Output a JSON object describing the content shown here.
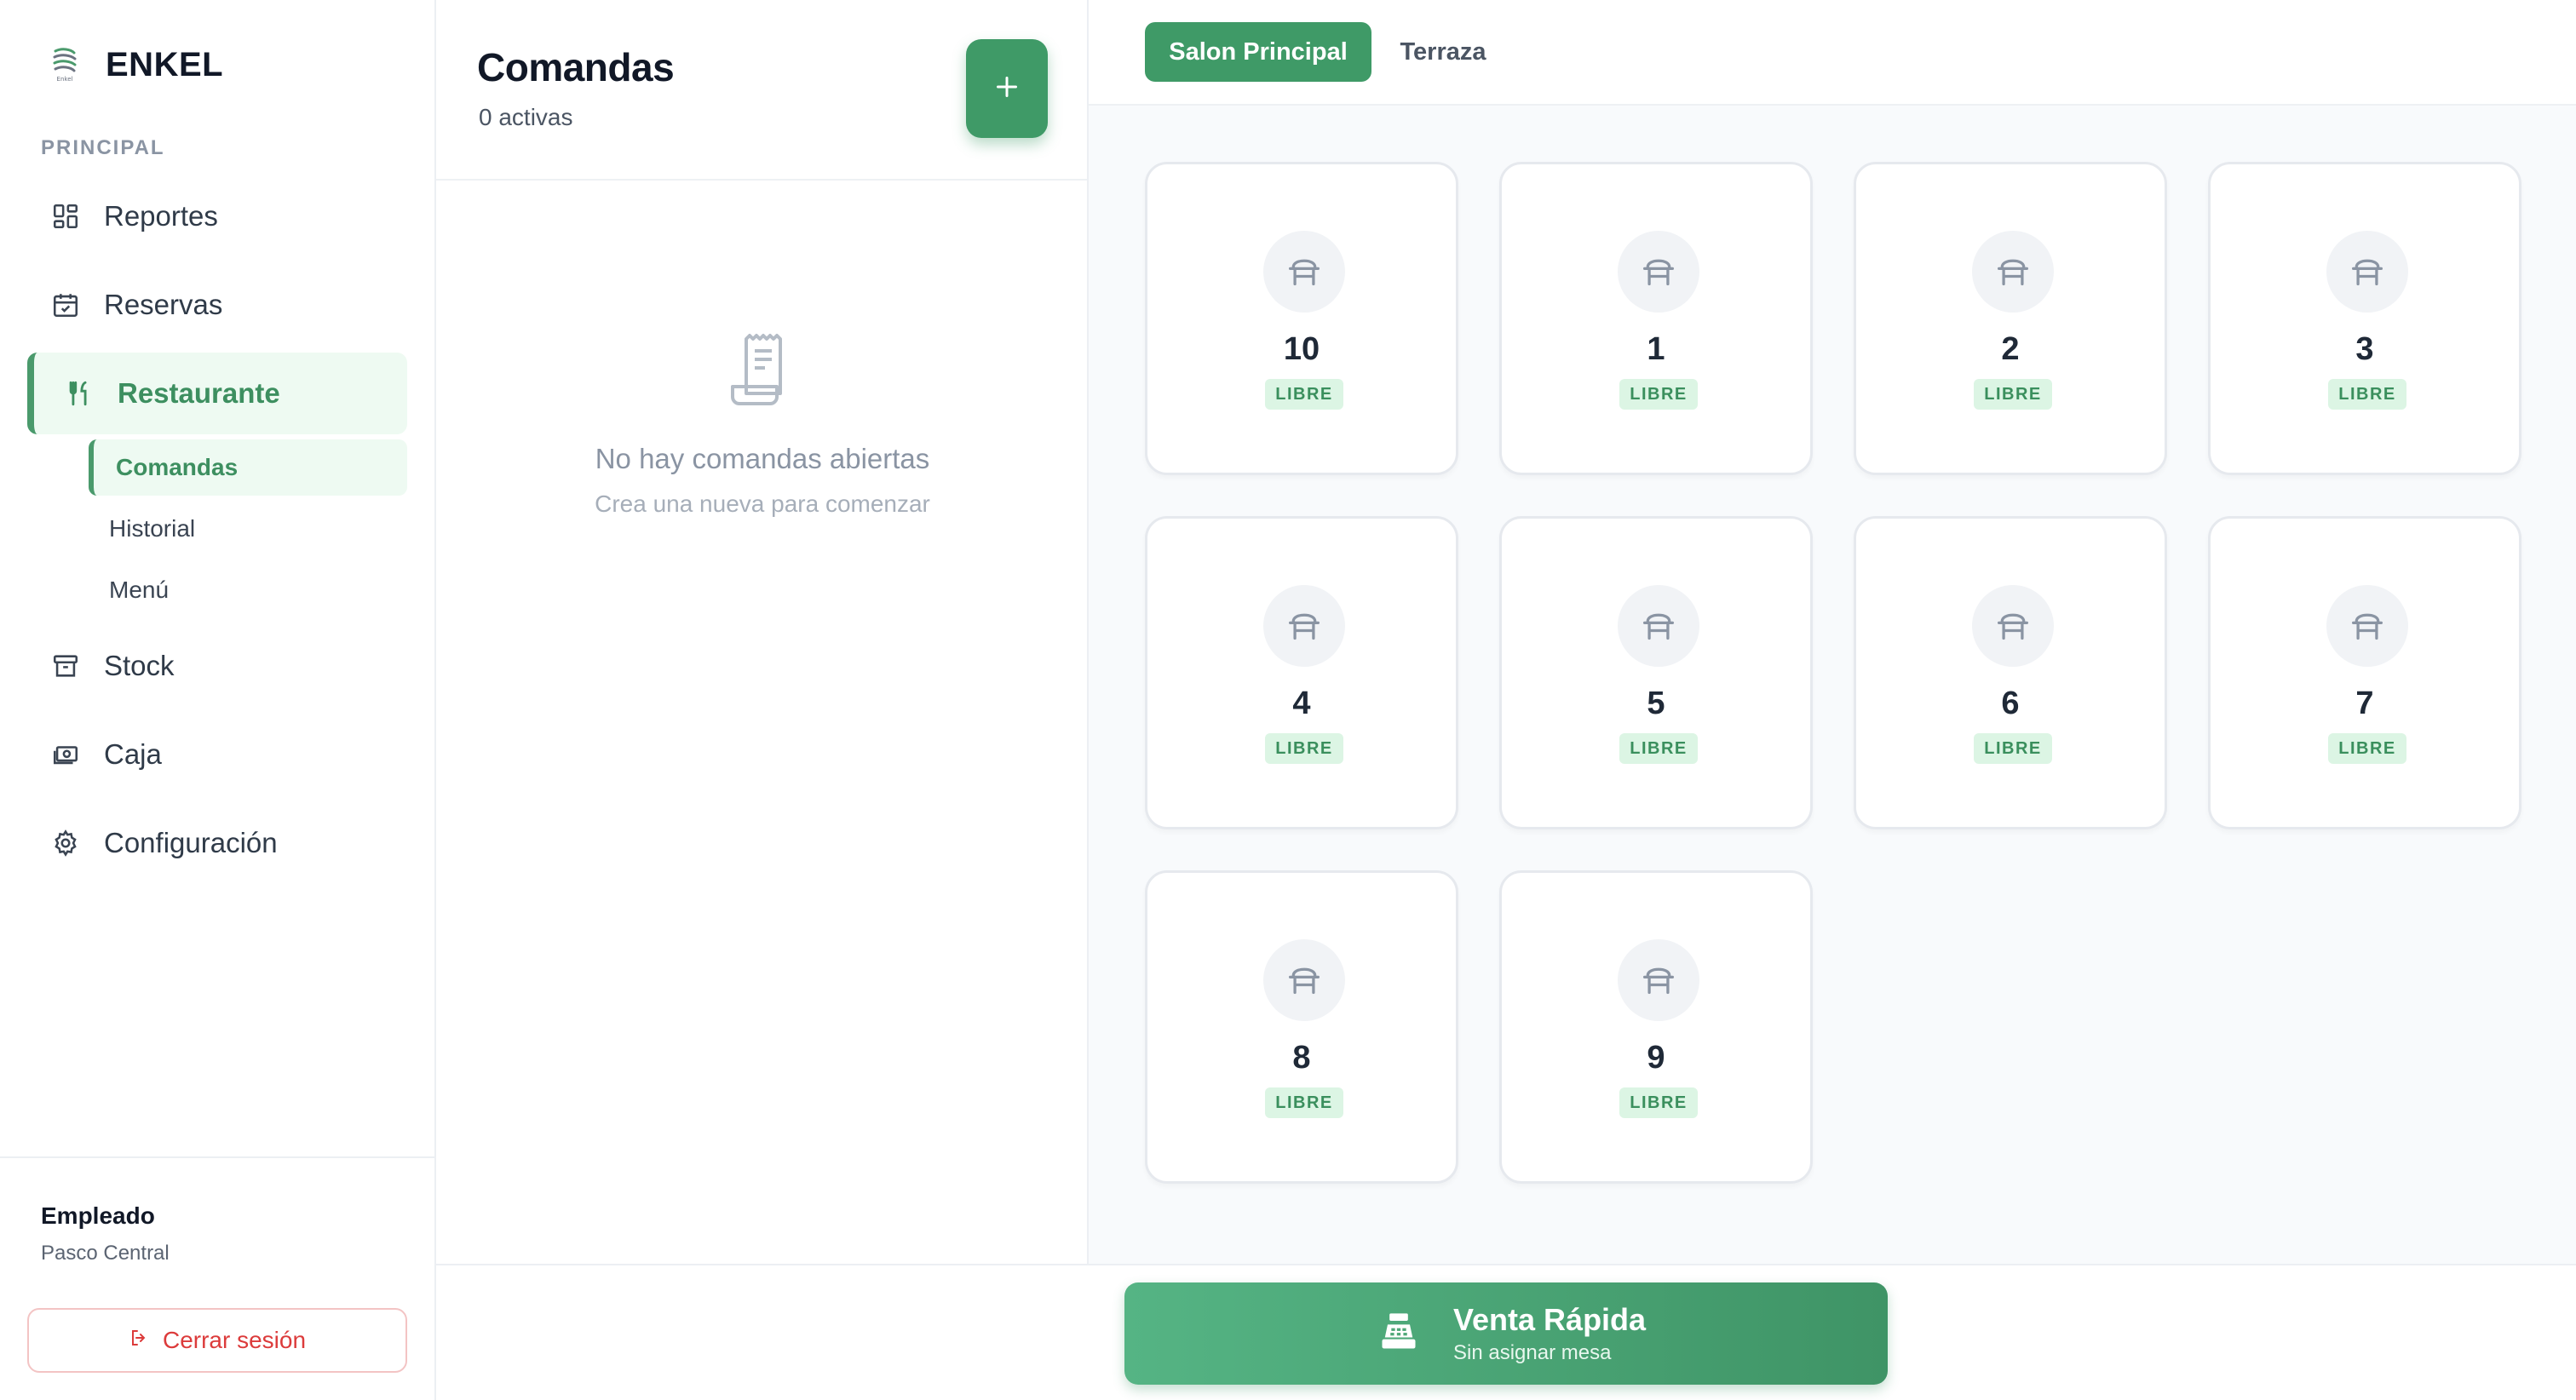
{
  "brand": {
    "name": "ENKEL",
    "logo_text": "Enkel"
  },
  "sidebar": {
    "section_label": "PRINCIPAL",
    "items": [
      {
        "label": "Reportes",
        "icon": "dashboard-grid-icon"
      },
      {
        "label": "Reservas",
        "icon": "calendar-check-icon"
      },
      {
        "label": "Restaurante",
        "icon": "fork-knife-icon",
        "active": true
      },
      {
        "label": "Stock",
        "icon": "archive-box-icon"
      },
      {
        "label": "Caja",
        "icon": "cash-icon"
      },
      {
        "label": "Configuración",
        "icon": "gear-icon"
      }
    ],
    "sub_items": [
      {
        "label": "Comandas",
        "active": true
      },
      {
        "label": "Historial"
      },
      {
        "label": "Menú"
      }
    ],
    "user": {
      "role": "Empleado",
      "location": "Pasco Central"
    },
    "logout_label": "Cerrar sesión"
  },
  "orders": {
    "title": "Comandas",
    "count_label": "0 activas",
    "empty_title": "No hay comandas abiertas",
    "empty_subtitle": "Crea una nueva para comenzar"
  },
  "tabs": [
    {
      "label": "Salon Principal",
      "active": true
    },
    {
      "label": "Terraza",
      "active": false
    }
  ],
  "tables": [
    {
      "number": "10",
      "status": "LIBRE"
    },
    {
      "number": "1",
      "status": "LIBRE"
    },
    {
      "number": "2",
      "status": "LIBRE"
    },
    {
      "number": "3",
      "status": "LIBRE"
    },
    {
      "number": "4",
      "status": "LIBRE"
    },
    {
      "number": "5",
      "status": "LIBRE"
    },
    {
      "number": "6",
      "status": "LIBRE"
    },
    {
      "number": "7",
      "status": "LIBRE"
    },
    {
      "number": "8",
      "status": "LIBRE"
    },
    {
      "number": "9",
      "status": "LIBRE"
    }
  ],
  "quick_sale": {
    "title": "Venta Rápida",
    "subtitle": "Sin asignar mesa"
  },
  "colors": {
    "accent": "#3f9a67",
    "active_bg": "#eefaf2",
    "danger": "#dc3b3b",
    "badge_bg": "#dcf5e4"
  }
}
